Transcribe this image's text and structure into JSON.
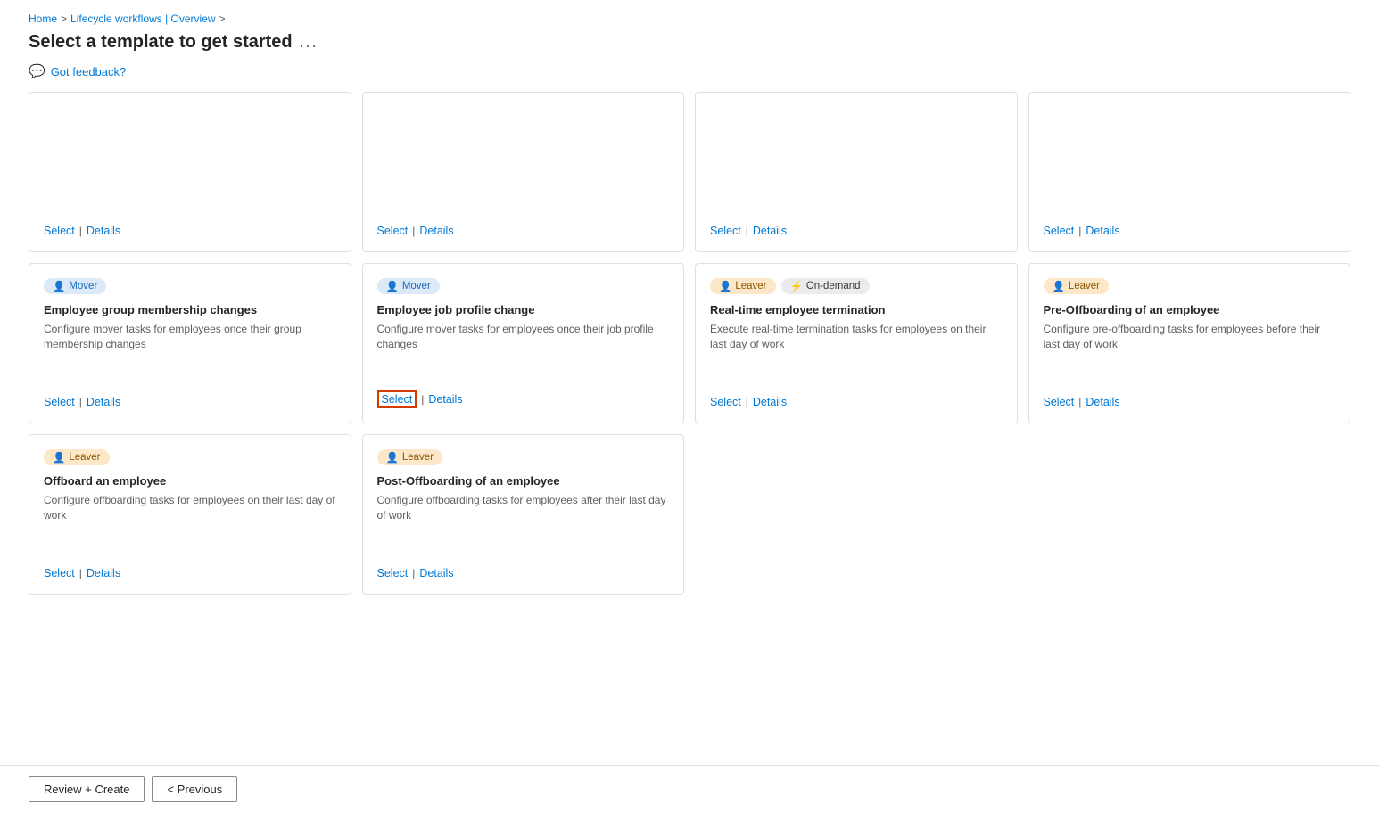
{
  "breadcrumb": {
    "home": "Home",
    "separator1": ">",
    "parent": "Lifecycle workflows | Overview",
    "separator2": ">"
  },
  "page": {
    "title": "Select a template to get started",
    "more_options": "...",
    "feedback_label": "Got feedback?"
  },
  "cards_row1": [
    {
      "id": "card-1-1",
      "badges": [],
      "title": "",
      "desc": "",
      "select_label": "Select",
      "details_label": "Details",
      "select_highlighted": false
    },
    {
      "id": "card-1-2",
      "badges": [],
      "title": "",
      "desc": "",
      "select_label": "Select",
      "details_label": "Details",
      "select_highlighted": false
    },
    {
      "id": "card-1-3",
      "badges": [],
      "title": "",
      "desc": "",
      "select_label": "Select",
      "details_label": "Details",
      "select_highlighted": false
    },
    {
      "id": "card-1-4",
      "badges": [],
      "title": "",
      "desc": "",
      "select_label": "Select",
      "details_label": "Details",
      "select_highlighted": false
    }
  ],
  "cards_row2": [
    {
      "id": "card-2-1",
      "badges": [
        {
          "type": "mover",
          "label": "Mover"
        }
      ],
      "title": "Employee group membership changes",
      "desc": "Configure mover tasks for employees once their group membership changes",
      "select_label": "Select",
      "details_label": "Details",
      "select_highlighted": false
    },
    {
      "id": "card-2-2",
      "badges": [
        {
          "type": "mover",
          "label": "Mover"
        }
      ],
      "title": "Employee job profile change",
      "desc": "Configure mover tasks for employees once their job profile changes",
      "select_label": "Select",
      "details_label": "Details",
      "select_highlighted": true
    },
    {
      "id": "card-2-3",
      "badges": [
        {
          "type": "leaver",
          "label": "Leaver"
        },
        {
          "type": "ondemand",
          "label": "On-demand"
        }
      ],
      "title": "Real-time employee termination",
      "desc": "Execute real-time termination tasks for employees on their last day of work",
      "select_label": "Select",
      "details_label": "Details",
      "select_highlighted": false
    },
    {
      "id": "card-2-4",
      "badges": [
        {
          "type": "leaver",
          "label": "Leaver"
        }
      ],
      "title": "Pre-Offboarding of an employee",
      "desc": "Configure pre-offboarding tasks for employees before their last day of work",
      "select_label": "Select",
      "details_label": "Details",
      "select_highlighted": false
    }
  ],
  "cards_row3": [
    {
      "id": "card-3-1",
      "badges": [
        {
          "type": "leaver",
          "label": "Leaver"
        }
      ],
      "title": "Offboard an employee",
      "desc": "Configure offboarding tasks for employees on their last day of work",
      "select_label": "Select",
      "details_label": "Details",
      "select_highlighted": false
    },
    {
      "id": "card-3-2",
      "badges": [
        {
          "type": "leaver",
          "label": "Leaver"
        }
      ],
      "title": "Post-Offboarding of an employee",
      "desc": "Configure offboarding tasks for employees after their last day of work",
      "select_label": "Select",
      "details_label": "Details",
      "select_highlighted": false
    }
  ],
  "footer": {
    "review_create_label": "Review + Create",
    "previous_label": "< Previous"
  }
}
